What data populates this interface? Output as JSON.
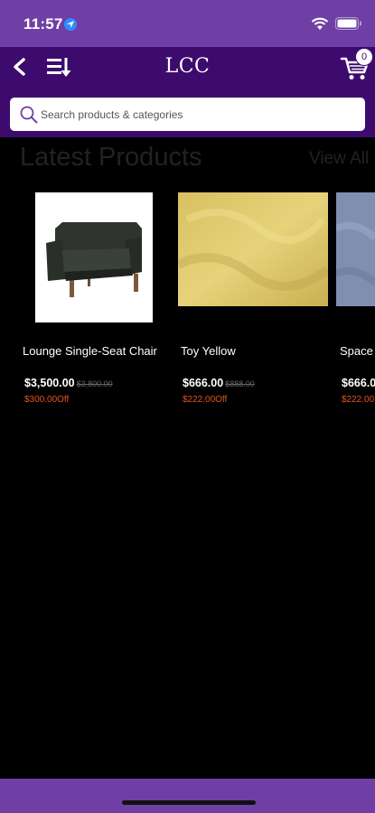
{
  "status_bar": {
    "time": "11:57"
  },
  "header": {
    "title": "LCC",
    "cart_count": "0"
  },
  "search": {
    "placeholder": "Search products & categories"
  },
  "section": {
    "title": "Latest Products",
    "view_all": "View All"
  },
  "products": [
    {
      "name": "Lounge Single-Seat Chair",
      "price": "$3,500.00",
      "old_price": "$3,800.00",
      "discount": "$300.00Off"
    },
    {
      "name": "Toy Yellow",
      "price": "$666.00",
      "old_price": "$888.00",
      "discount": "$222.00Off"
    },
    {
      "name": "Space",
      "price": "$666.0",
      "old_price": "",
      "discount": "$222.00"
    }
  ],
  "colors": {
    "status_bar": "#6f3fa6",
    "nav_bar": "#3d0b6e",
    "discount": "#e4531e",
    "background": "#000000"
  }
}
